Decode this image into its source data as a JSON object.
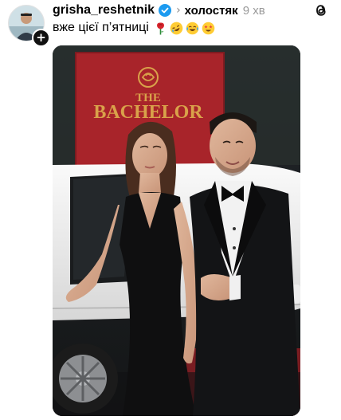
{
  "post": {
    "username": "grisha_reshetnik",
    "topic": "холостяк",
    "time": "9 хв",
    "caption_text": "вже цієї п’ятниці",
    "emojis": [
      "rose-emoji",
      "rofl-emoji",
      "joy-emoji",
      "star-struck-emoji"
    ],
    "photo": {
      "sign_line1": "THE",
      "sign_line2": "BACHELOR"
    }
  },
  "icons": {
    "verified": "verified-badge-icon",
    "threads": "threads-logo-icon",
    "plus": "plus-icon"
  },
  "colors": {
    "verified_blue": "#1d9bf0",
    "sign_red": "#a8242a",
    "gold": "#d9a24a",
    "meta_gray": "#999999"
  }
}
